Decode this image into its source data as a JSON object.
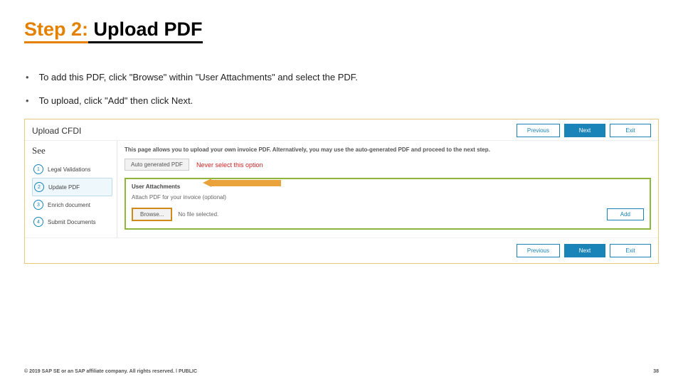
{
  "title": {
    "step": "Step 2:",
    "rest": " Upload PDF"
  },
  "bullets": [
    "To add this PDF, click \"Browse\" within \"User Attachments\" and select the PDF.",
    "To upload, click \"Add\" then click Next."
  ],
  "app": {
    "header_title": "Upload CFDI",
    "top_buttons": {
      "previous": "Previous",
      "next": "Next",
      "exit": "Exit"
    },
    "see_label": "See",
    "steps": [
      {
        "num": "1",
        "label": "Legal Validations"
      },
      {
        "num": "2",
        "label": "Update PDF"
      },
      {
        "num": "3",
        "label": "Enrich document"
      },
      {
        "num": "4",
        "label": "Submit Documents"
      }
    ],
    "intro": "This page allows you to upload your own invoice PDF. Alternatively, you may use the auto-generated PDF and proceed to the next step.",
    "autogen_label": "Auto generated PDF",
    "warning": "Never select this option",
    "ua_title": "User Attachments",
    "ua_sub": "Attach PDF for your invoice (optional)",
    "browse_label": "Browse...",
    "nofile": "No file selected.",
    "add_label": "Add",
    "bottom_buttons": {
      "previous": "Previous",
      "next": "Next",
      "exit": "Exit"
    }
  },
  "footer": {
    "copyright": "© 2019 SAP SE or an SAP affiliate company. All rights reserved. ǀ PUBLIC",
    "page": "38"
  }
}
